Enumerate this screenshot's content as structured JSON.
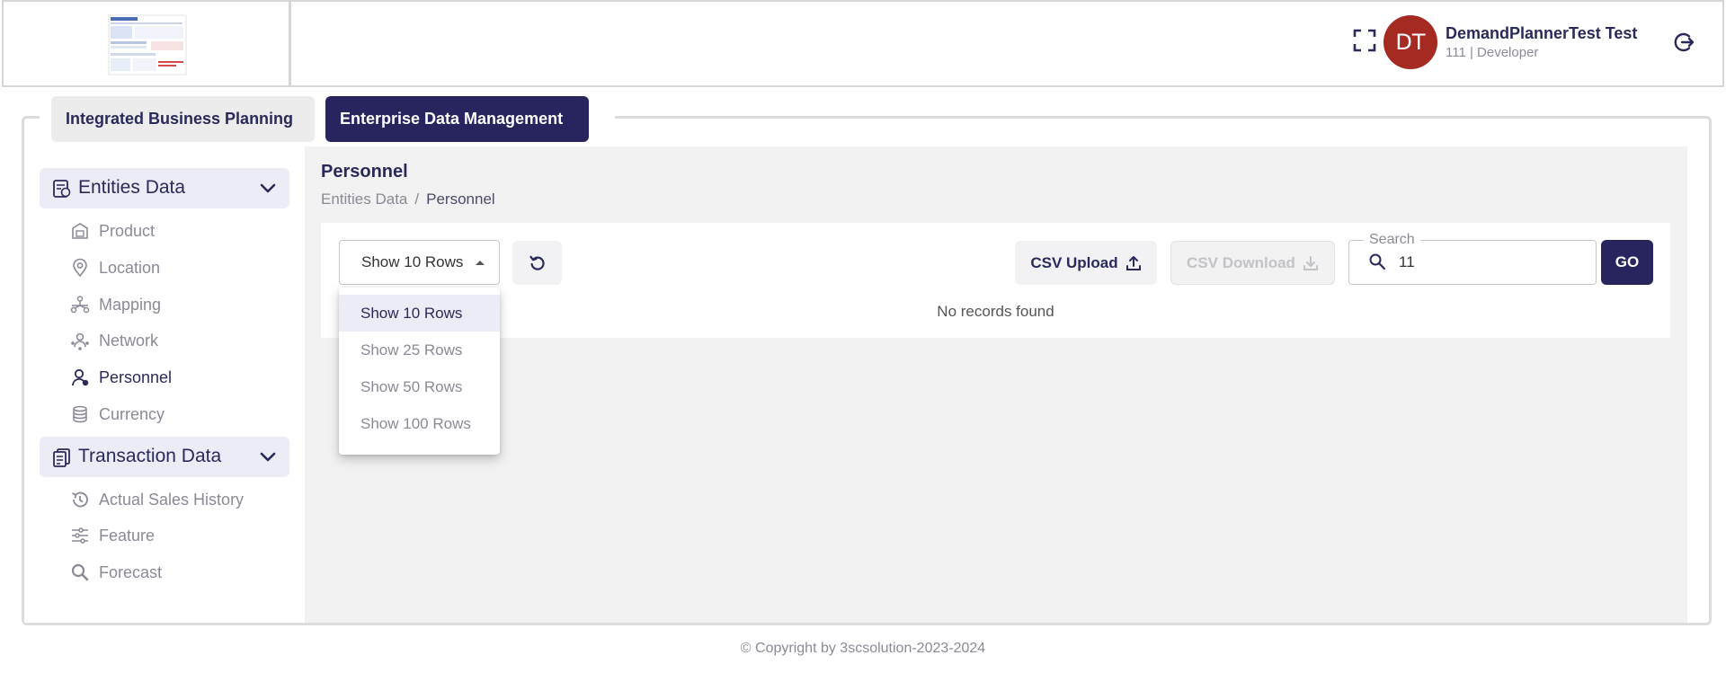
{
  "header": {
    "user_initials": "DT",
    "user_name": "DemandPlannerTest Test",
    "user_role": "111 | Developer",
    "avatar_color": "#a52a22"
  },
  "tabs": [
    {
      "label": "Integrated Business Planning",
      "active": false
    },
    {
      "label": "Enterprise Data Management",
      "active": true
    }
  ],
  "sidebar": {
    "entities": {
      "label": "Entities Data",
      "icon": "entities-icon",
      "items": [
        {
          "label": "Product",
          "icon": "product-icon"
        },
        {
          "label": "Location",
          "icon": "location-pin-icon"
        },
        {
          "label": "Mapping",
          "icon": "mapping-icon"
        },
        {
          "label": "Network",
          "icon": "network-icon"
        },
        {
          "label": "Personnel",
          "icon": "personnel-icon",
          "active": true
        },
        {
          "label": "Currency",
          "icon": "currency-icon"
        }
      ]
    },
    "transactions": {
      "label": "Transaction Data",
      "icon": "transaction-icon",
      "items": [
        {
          "label": "Actual Sales History",
          "icon": "history-icon"
        },
        {
          "label": "Feature",
          "icon": "feature-icon"
        },
        {
          "label": "Forecast",
          "icon": "search-icon"
        }
      ]
    }
  },
  "main": {
    "title": "Personnel",
    "breadcrumb": [
      "Entities Data",
      "Personnel"
    ],
    "breadcrumb_sep": "/",
    "rows_select": "Show 10 Rows",
    "csv_upload": "CSV Upload",
    "csv_download": "CSV Download",
    "search_label": "Search",
    "search_value": "11",
    "go": "GO",
    "empty_text": "No records found"
  },
  "dropdown": {
    "options": [
      "Show 10 Rows",
      "Show 25 Rows",
      "Show 50 Rows",
      "Show 100 Rows"
    ],
    "selected": "Show 10 Rows"
  },
  "footer": "© Copyright by 3scsolution-2023-2024",
  "colors": {
    "primary": "#27245e",
    "accent_bg": "#ececf7",
    "muted_text": "#8a8a96"
  }
}
